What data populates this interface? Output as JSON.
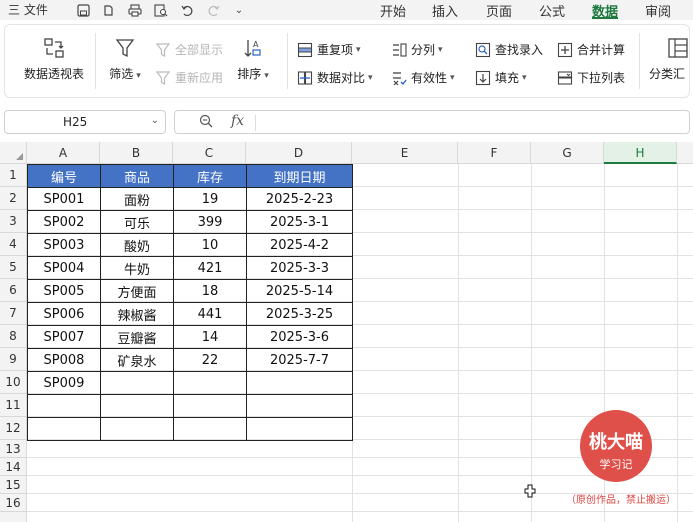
{
  "menubar": {
    "file_label": "三 文件",
    "tabs": [
      "开始",
      "插入",
      "页面",
      "公式",
      "数据",
      "审阅"
    ],
    "active_tab": "数据"
  },
  "ribbon": {
    "pivot": "数据透视表",
    "filter": "筛选",
    "show_all": "全部显示",
    "reapply": "重新应用",
    "sort": "排序",
    "duplicates": "重复项",
    "compare": "数据对比",
    "split": "分列",
    "validity": "有效性",
    "lookup": "查找录入",
    "fill": "填充",
    "consolidate": "合并计算",
    "dropdown_list": "下拉列表",
    "subtotal": "分类汇"
  },
  "formula_bar": {
    "name_box": "H25",
    "fx": "fx",
    "content": ""
  },
  "sheet": {
    "columns": [
      "A",
      "B",
      "C",
      "D",
      "E",
      "F",
      "G",
      "H"
    ],
    "active_column": "H",
    "rows": [
      "1",
      "2",
      "3",
      "4",
      "5",
      "6",
      "7",
      "8",
      "9",
      "10",
      "11",
      "12",
      "13",
      "14",
      "15",
      "16"
    ],
    "table_header": [
      "编号",
      "商品",
      "库存",
      "到期日期"
    ],
    "table_rows": [
      [
        "SP001",
        "面粉",
        "19",
        "2025-2-23"
      ],
      [
        "SP002",
        "可乐",
        "399",
        "2025-3-1"
      ],
      [
        "SP003",
        "酸奶",
        "10",
        "2025-4-2"
      ],
      [
        "SP004",
        "牛奶",
        "421",
        "2025-3-3"
      ],
      [
        "SP005",
        "方便面",
        "18",
        "2025-5-14"
      ],
      [
        "SP006",
        "辣椒酱",
        "441",
        "2025-3-25"
      ],
      [
        "SP007",
        "豆瓣酱",
        "14",
        "2025-3-6"
      ],
      [
        "SP008",
        "矿泉水",
        "22",
        "2025-7-7"
      ],
      [
        "SP009",
        "",
        "",
        ""
      ],
      [
        "",
        "",
        "",
        ""
      ],
      [
        "",
        "",
        "",
        ""
      ]
    ]
  },
  "watermark": {
    "title": "桃大喵",
    "subtitle": "学习记",
    "note": "（原创作品，禁止搬运）"
  }
}
